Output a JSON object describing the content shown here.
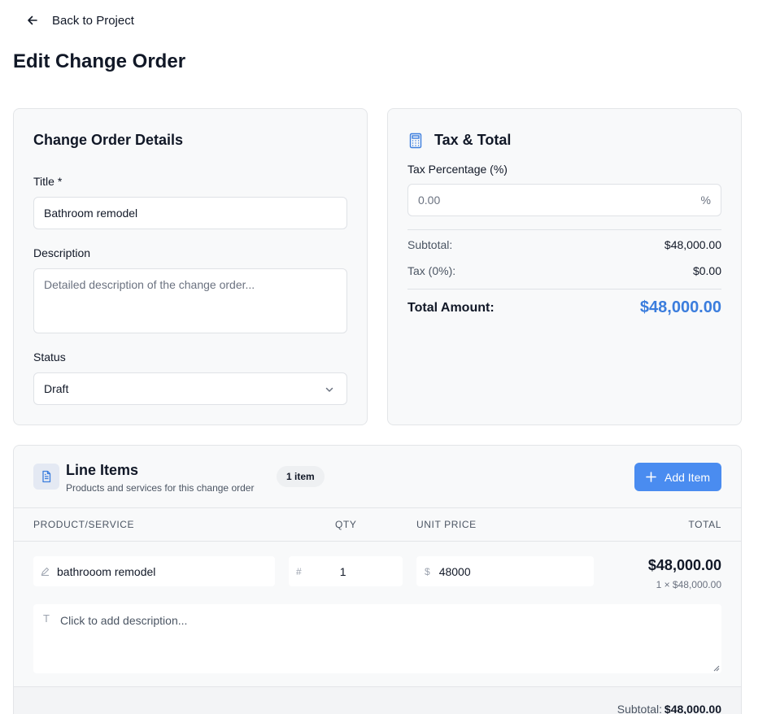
{
  "nav": {
    "back_label": "Back to Project"
  },
  "page": {
    "title": "Edit Change Order"
  },
  "details": {
    "title": "Change Order Details",
    "title_label": "Title *",
    "title_value": "Bathroom remodel",
    "description_label": "Description",
    "description_placeholder": "Detailed description of the change order...",
    "status_label": "Status",
    "status_value": "Draft"
  },
  "tax": {
    "title": "Tax & Total",
    "tax_pct_label": "Tax Percentage (%)",
    "tax_pct_placeholder": "0.00",
    "tax_pct_suffix": "%",
    "subtotal_label": "Subtotal:",
    "subtotal_value": "$48,000.00",
    "tax_label": "Tax (0%):",
    "tax_value": "$0.00",
    "total_label": "Total Amount:",
    "total_value": "$48,000.00"
  },
  "line_items": {
    "title": "Line Items",
    "subtitle": "Products and services for this change order",
    "count_badge": "1 item",
    "add_label": "Add Item",
    "columns": [
      "PRODUCT/SERVICE",
      "QTY",
      "UNIT PRICE",
      "TOTAL"
    ],
    "items": [
      {
        "name": "bathrooom remodel",
        "qty_prefix": "#",
        "qty": "1",
        "price_prefix": "$",
        "unit_price": "48000",
        "total": "$48,000.00",
        "calc": "1 × $48,000.00",
        "description_placeholder": "Click to add description..."
      }
    ],
    "subtotal_label": "Subtotal:",
    "subtotal_value": "$48,000.00"
  },
  "colors": {
    "accent": "#4a8cf0",
    "total": "#3b7ddd"
  }
}
